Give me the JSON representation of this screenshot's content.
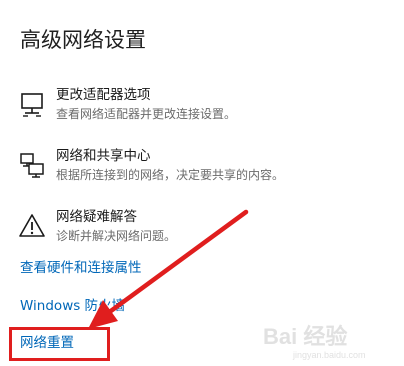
{
  "header": {
    "title": "高级网络设置"
  },
  "options": [
    {
      "label": "更改适配器选项",
      "description": "查看网络适配器并更改连接设置。",
      "icon": "monitor-network-icon"
    },
    {
      "label": "网络和共享中心",
      "description": "根据所连接到的网络，决定要共享的内容。",
      "icon": "sharing-center-icon"
    },
    {
      "label": "网络疑难解答",
      "description": "诊断并解决网络问题。",
      "icon": "warning-icon"
    }
  ],
  "links": {
    "hardware": "查看硬件和连接属性",
    "firewall": "Windows 防火墙",
    "reset": "网络重置"
  },
  "annotation": {
    "color": "#e01e1e",
    "watermark": "Bai 经验",
    "watermark_url": "jingyan.baidu.com"
  },
  "colors": {
    "link": "#0067b8",
    "description": "#6b6b6b"
  }
}
